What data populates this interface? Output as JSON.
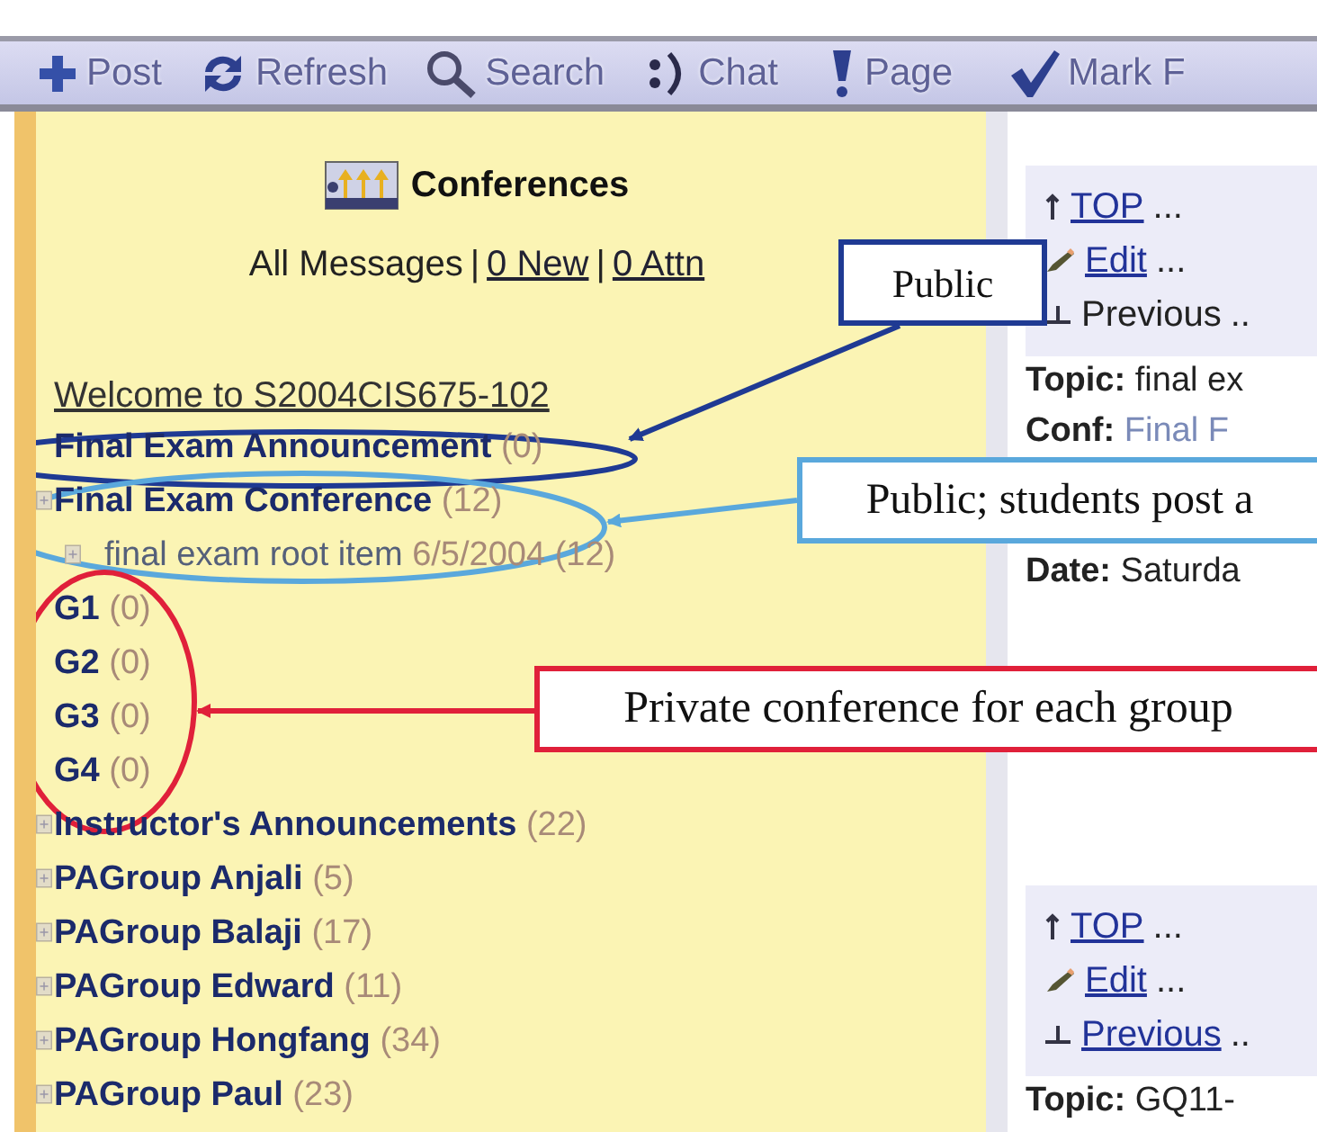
{
  "toolbar": [
    {
      "kind": "post",
      "label": "Post"
    },
    {
      "kind": "refresh",
      "label": "Refresh"
    },
    {
      "kind": "search",
      "label": "Search"
    },
    {
      "kind": "chat",
      "label": "Chat"
    },
    {
      "kind": "page",
      "label": "Page"
    },
    {
      "kind": "mark",
      "label": "Mark F"
    }
  ],
  "conferences": {
    "title": "Conferences",
    "separator": "|",
    "filters": [
      {
        "label": "All Messages",
        "link": false
      },
      {
        "label": "0 New",
        "link": true
      },
      {
        "label": "0 Attn",
        "link": true
      }
    ],
    "welcome": "Welcome to S2004CIS675-102",
    "tree": [
      {
        "name": "Final Exam Announcement",
        "count": "(0)",
        "expandable": false
      },
      {
        "name": "Final Exam Conference",
        "count": "(12)",
        "expandable": true,
        "children": [
          {
            "name": "final exam root item",
            "count": "6/5/2004 (12)",
            "expandable": true
          }
        ]
      },
      {
        "name": "G1",
        "count": "(0)",
        "expandable": false
      },
      {
        "name": "G2",
        "count": "(0)",
        "expandable": false
      },
      {
        "name": "G3",
        "count": "(0)",
        "expandable": false
      },
      {
        "name": "G4",
        "count": "(0)",
        "expandable": false
      },
      {
        "name": "Instructor's Announcements",
        "count": "(22)",
        "expandable": true
      },
      {
        "name": "PAGroup Anjali",
        "count": "(5)",
        "expandable": true
      },
      {
        "name": "PAGroup Balaji",
        "count": "(17)",
        "expandable": true
      },
      {
        "name": "PAGroup Edward",
        "count": "(11)",
        "expandable": true
      },
      {
        "name": "PAGroup Hongfang",
        "count": "(34)",
        "expandable": true
      },
      {
        "name": "PAGroup Paul",
        "count": "(23)",
        "expandable": true
      }
    ]
  },
  "messages": [
    {
      "actions": [
        {
          "kind": "top",
          "label": "TOP",
          "link": true,
          "trail": "..."
        },
        {
          "kind": "edit",
          "label": "Edit",
          "link": true,
          "trail": "..."
        },
        {
          "kind": "previous",
          "label": "Previous",
          "link": false,
          "trail": ".."
        }
      ],
      "fields": [
        {
          "label": "Topic:",
          "value": "final ex",
          "link": false
        },
        {
          "label": "Conf:",
          "value": "Final F",
          "link": true
        },
        {
          "label": "Date:",
          "value": "Saturda",
          "link": false
        }
      ]
    },
    {
      "actions": [
        {
          "kind": "top",
          "label": "TOP",
          "link": true,
          "trail": "..."
        },
        {
          "kind": "edit",
          "label": "Edit",
          "link": true,
          "trail": "..."
        },
        {
          "kind": "previous",
          "label": "Previous",
          "link": true,
          "trail": ".."
        }
      ],
      "fields": [
        {
          "label": "Topic:",
          "value": "GQ11-",
          "link": false
        }
      ]
    }
  ],
  "annotations": [
    {
      "text": "Public",
      "color": "#1f3a93"
    },
    {
      "text": "Public; students post a",
      "color": "#5aa8dc"
    },
    {
      "text": "Private conference for each group",
      "color": "#e0203a"
    }
  ]
}
